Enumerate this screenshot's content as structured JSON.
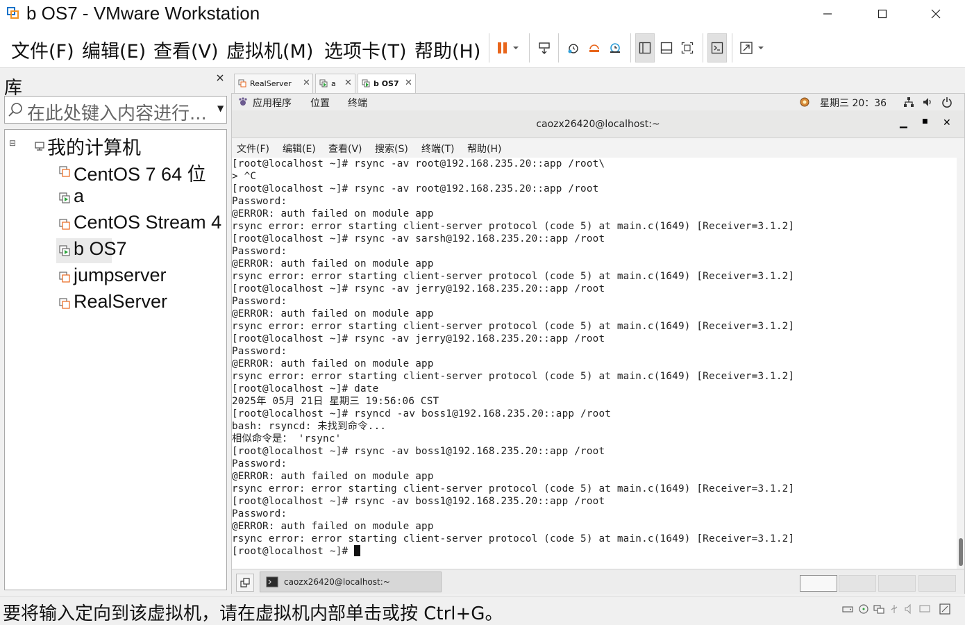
{
  "window": {
    "title": "b OS7 - VMware Workstation",
    "controls": [
      "minimize",
      "maximize",
      "close"
    ]
  },
  "menubar": {
    "items": [
      "文件(F)",
      "编辑(E)",
      "查看(V)",
      "虚拟机(M)",
      "选项卡(T)",
      "帮助(H)"
    ]
  },
  "toolbar": {
    "icons": [
      "pause-icon",
      "send-ctrl-alt-del-icon",
      "snapshot-take-icon",
      "snapshot-revert-icon",
      "snapshot-manager-icon",
      "library-view-icon",
      "thumbnail-view-icon",
      "fullscreen-icon",
      "console-view-icon",
      "stretch-icon"
    ],
    "pause_color": "#e8661c"
  },
  "library": {
    "title": "库",
    "search_placeholder": "在此处键入内容进行...",
    "tree": {
      "root": "我的计算机",
      "items": [
        {
          "label": "CentOS 7 64 位",
          "running": false
        },
        {
          "label": "a",
          "running": true
        },
        {
          "label": "CentOS Stream 4",
          "running": false
        },
        {
          "label": "b OS7",
          "running": true,
          "selected": true
        },
        {
          "label": "jumpserver",
          "running": false
        },
        {
          "label": "RealServer",
          "running": false
        }
      ]
    }
  },
  "tabs": [
    {
      "label": "RealServer",
      "active": false
    },
    {
      "label": "a",
      "active": false
    },
    {
      "label": "b OS7",
      "active": true
    }
  ],
  "guest": {
    "top_panel": {
      "applications": "应用程序",
      "places": "位置",
      "terminal": "终端",
      "clock": "星期三 20：36"
    },
    "terminal": {
      "title": "caozx26420@localhost:~",
      "menu": [
        "文件(F)",
        "编辑(E)",
        "查看(V)",
        "搜索(S)",
        "终端(T)",
        "帮助(H)"
      ],
      "lines": [
        "[root@localhost ~]# rsync -av root@192.168.235.20::app /root\\",
        "> ^C",
        "[root@localhost ~]# rsync -av root@192.168.235.20::app /root",
        "Password:",
        "@ERROR: auth failed on module app",
        "rsync error: error starting client-server protocol (code 5) at main.c(1649) [Receiver=3.1.2]",
        "[root@localhost ~]# rsync -av sarsh@192.168.235.20::app /root",
        "Password:",
        "@ERROR: auth failed on module app",
        "rsync error: error starting client-server protocol (code 5) at main.c(1649) [Receiver=3.1.2]",
        "[root@localhost ~]# rsync -av jerry@192.168.235.20::app /root",
        "Password:",
        "@ERROR: auth failed on module app",
        "rsync error: error starting client-server protocol (code 5) at main.c(1649) [Receiver=3.1.2]",
        "[root@localhost ~]# rsync -av jerry@192.168.235.20::app /root",
        "Password:",
        "@ERROR: auth failed on module app",
        "rsync error: error starting client-server protocol (code 5) at main.c(1649) [Receiver=3.1.2]",
        "[root@localhost ~]# date",
        "2025年 05月 21日 星期三 19:56:06 CST",
        "[root@localhost ~]# rsyncd -av boss1@192.168.235.20::app /root",
        "bash: rsyncd: 未找到命令...",
        "相似命令是： 'rsync'",
        "[root@localhost ~]# rsync -av boss1@192.168.235.20::app /root",
        "Password:",
        "@ERROR: auth failed on module app",
        "rsync error: error starting client-server protocol (code 5) at main.c(1649) [Receiver=3.1.2]",
        "[root@localhost ~]# rsync -av boss1@192.168.235.20::app /root",
        "Password:",
        "@ERROR: auth failed on module app",
        "rsync error: error starting client-server protocol (code 5) at main.c(1649) [Receiver=3.1.2]"
      ],
      "prompt": "[root@localhost ~]# "
    },
    "taskbar": {
      "window_label": "caozx26420@localhost:~",
      "workspaces": 4
    }
  },
  "statusbar": {
    "text": "要将输入定向到该虚拟机，请在虚拟机内部单击或按 Ctrl+G。",
    "icons": [
      "hdd-icon",
      "cdrom-icon",
      "network-icon",
      "usb-icon",
      "sound-icon",
      "display-icon",
      "message-icon"
    ]
  }
}
